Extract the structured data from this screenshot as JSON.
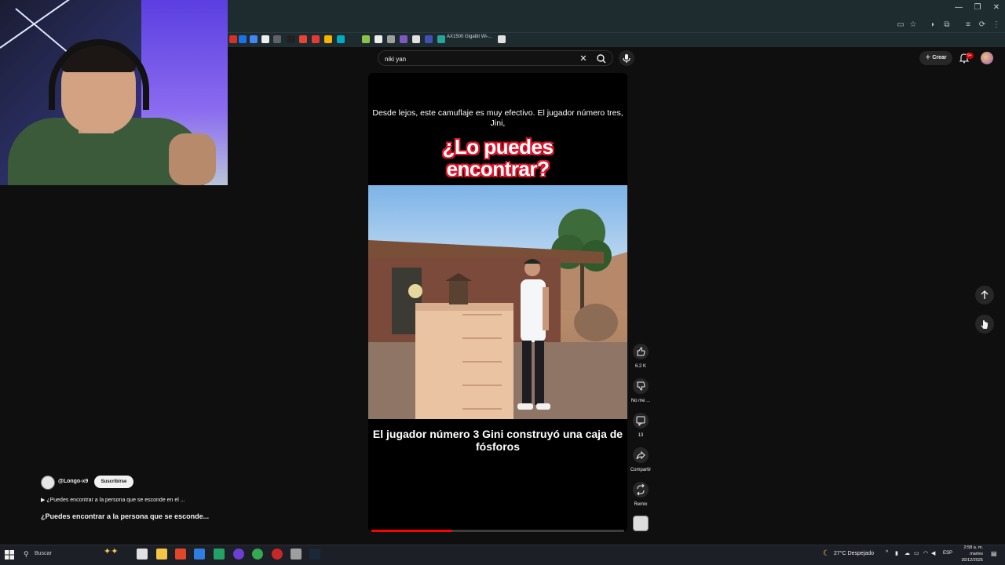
{
  "browser": {
    "bookmark_label": "AX1500 Gigabit Wi-...",
    "window_buttons": [
      "—",
      "❐",
      "✕"
    ]
  },
  "search": {
    "value": "niki yan",
    "clear_icon": "close-icon",
    "search_icon": "search-icon",
    "mic_icon": "mic-icon"
  },
  "header": {
    "create_label": "Crear",
    "notification_count": "9+"
  },
  "video": {
    "caption_top": "Desde lejos, este camuflaje es muy efectivo. El jugador número tres, Jini,",
    "title_overlay_line1": "¿Lo puedes",
    "title_overlay_line2": "encontrar?",
    "caption_bottom": "El jugador número 3 Gini construyó una caja de fósforos",
    "progress": 0.32
  },
  "actions": {
    "like_count": "6.2 K",
    "dislike_label": "No me ...",
    "comments_count": "13",
    "share_label": "Compartir",
    "remix_label": "Remix"
  },
  "channel": {
    "handle": "@Longo-x9",
    "subscribe_label": "Suscribirse",
    "description": "¿Puedes encontrar a la persona que se esconde en el ...",
    "title": "¿Puedes encontrar a la persona que se esconde..."
  },
  "taskbar": {
    "search_label": "Buscar",
    "weather": "27°C  Despejado",
    "language": "ESP",
    "time": "2:58 a. m.",
    "day": "martes",
    "date": "30/12/2025"
  },
  "colors": {
    "background": "#0f0f0f",
    "accent_red": "#ff0000",
    "title_outline": "#e0142a",
    "chrome": "#1e2b2f"
  }
}
